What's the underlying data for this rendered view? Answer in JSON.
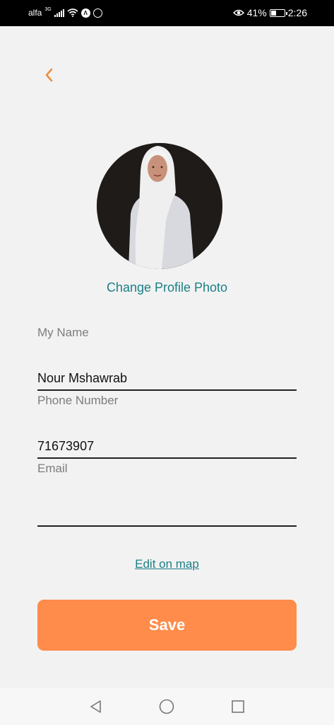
{
  "status_bar": {
    "carrier": "alfa",
    "network_type": "3G",
    "battery_percent": "41%",
    "battery_level": 0.41,
    "time": "2:26",
    "icons": [
      "signal-icon",
      "wifi-icon",
      "app-notification-icon",
      "whatsapp-icon",
      "eye-comfort-icon",
      "battery-icon"
    ]
  },
  "header": {
    "back_icon": "chevron-left-icon"
  },
  "profile": {
    "photo_alt": "profile photo",
    "change_photo_label": "Change Profile Photo"
  },
  "form": {
    "name": {
      "label": "My Name",
      "value": "Nour Mshawrab"
    },
    "phone": {
      "label": "Phone Number",
      "value": "71673907"
    },
    "email": {
      "label": "Email",
      "value": ""
    }
  },
  "edit_map_label": "Edit on map",
  "save_label": "Save",
  "nav_bar": {
    "icons": [
      "back-triangle-icon",
      "home-circle-icon",
      "recents-square-icon"
    ]
  },
  "colors": {
    "accent": "#ff8c4b",
    "link": "#1b7f85",
    "background": "#f2f2f2",
    "status_bar": "#000000"
  }
}
